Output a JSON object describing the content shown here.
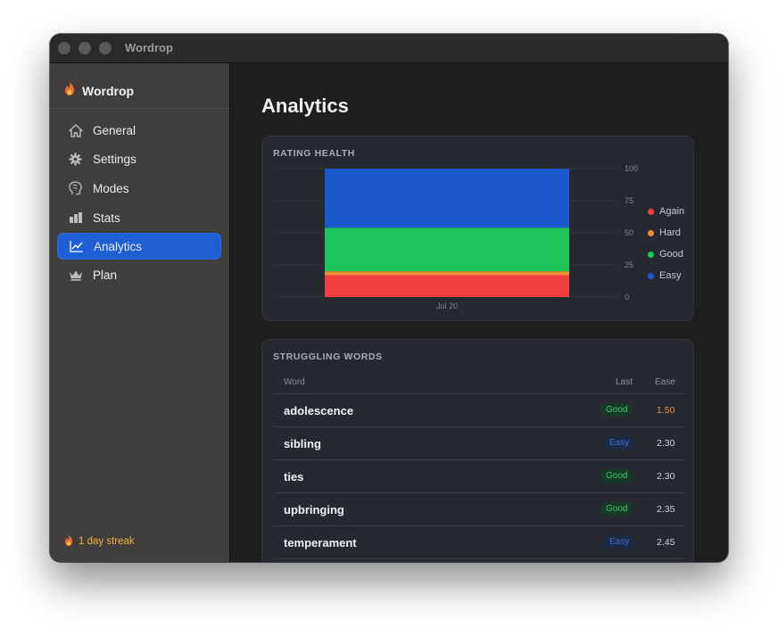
{
  "window": {
    "title": "Wordrop"
  },
  "sidebar": {
    "brand": "Wordrop",
    "items": [
      {
        "label": "General",
        "icon": "house-icon",
        "active": false
      },
      {
        "label": "Settings",
        "icon": "gear-icon",
        "active": false
      },
      {
        "label": "Modes",
        "icon": "head-icon",
        "active": false
      },
      {
        "label": "Stats",
        "icon": "bar-chart-icon",
        "active": false
      },
      {
        "label": "Analytics",
        "icon": "line-chart-icon",
        "active": true
      },
      {
        "label": "Plan",
        "icon": "crown-icon",
        "active": false
      }
    ],
    "streak": "1 day streak"
  },
  "main": {
    "title": "Analytics"
  },
  "rating_health": {
    "title": "RATING HEALTH",
    "chart_data": {
      "type": "bar",
      "stacked": true,
      "categories": [
        "Jul 20"
      ],
      "series": [
        {
          "name": "Again",
          "values": [
            17
          ],
          "color": "#f03f3e"
        },
        {
          "name": "Hard",
          "values": [
            3
          ],
          "color": "#f08d34"
        },
        {
          "name": "Good",
          "values": [
            34
          ],
          "color": "#21c65b"
        },
        {
          "name": "Easy",
          "values": [
            46
          ],
          "color": "#1a5acc"
        }
      ],
      "ylim": [
        0,
        100
      ],
      "yticks": [
        "100",
        "75",
        "50",
        "25",
        "0"
      ],
      "grid": true,
      "legend": "right"
    }
  },
  "struggling_words": {
    "title": "STRUGGLING WORDS",
    "columns": {
      "word": "Word",
      "last": "Last",
      "ease": "Ease"
    },
    "rows": [
      {
        "word": "adolescence",
        "last": "Good",
        "ease": "1.50"
      },
      {
        "word": "sibling",
        "last": "Easy",
        "ease": "2.30"
      },
      {
        "word": "ties",
        "last": "Good",
        "ease": "2.30"
      },
      {
        "word": "upbringing",
        "last": "Good",
        "ease": "2.35"
      },
      {
        "word": "temperament",
        "last": "Easy",
        "ease": "2.45"
      }
    ]
  }
}
